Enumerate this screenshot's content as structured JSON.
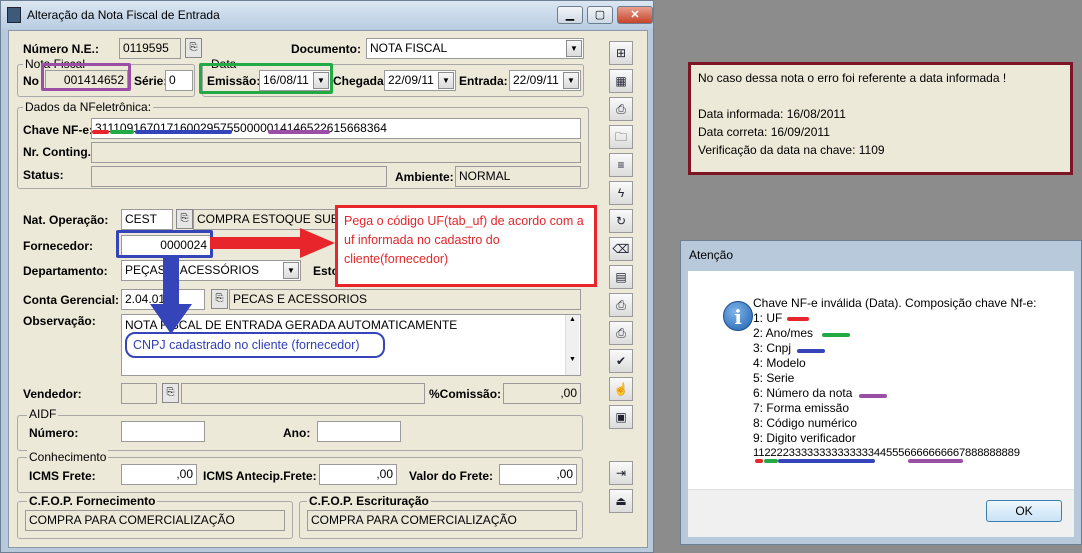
{
  "window": {
    "title": "Alteração da Nota Fiscal de Entrada",
    "minimize_label": "▁",
    "maximize_label": "▢",
    "close_label": "✕"
  },
  "form": {
    "numero_ne_label": "Número N.E.:",
    "numero_ne_value": "0119595",
    "documento_label": "Documento:",
    "documento_value": "NOTA FISCAL",
    "nota_fiscal_group": "Nota Fiscal",
    "no_label": "No",
    "no_value": "001414652",
    "serie_label": "Série:",
    "serie_value": "0",
    "data_group": "Data",
    "emissao_label": "Emissão:",
    "emissao_value": "16/08/11",
    "chegada_label": "Chegada:",
    "chegada_value": "22/09/11",
    "entrada_label": "Entrada:",
    "entrada_value": "22/09/11",
    "nfe_group": "Dados da NFeletrônica:",
    "chave_label": "Chave NF-e:",
    "chave_value": "31110916701716002957550000014146522615668364",
    "contingencia_label": "Nr. Conting.:",
    "status_label": "Status:",
    "ambiente_label": "Ambiente:",
    "ambiente_value": "NORMAL",
    "natop_label": "Nat. Operação:",
    "natop_code": "CEST",
    "natop_desc": "COMPRA ESTOQUE SUB",
    "fornecedor_label": "Fornecedor:",
    "fornecedor_value": "0000024",
    "departamento_label": "Departamento:",
    "departamento_value": "PEÇAS E ACESSÓRIOS",
    "esto_label": "Esto",
    "conta_label": "Conta Gerencial:",
    "conta_code": "2.04.01",
    "conta_desc": "PECAS E ACESSORIOS",
    "observacao_label": "Observação:",
    "observacao_value": "NOTA FISCAL DE ENTRADA GERADA AUTOMATICAMENTE",
    "vendedor_label": "Vendedor:",
    "comissao_label": "%Comissão:",
    "comissao_value": ",00",
    "aidf_group": "AIDF",
    "aidf_numero_label": "Número:",
    "aidf_ano_label": "Ano:",
    "conhecimento_group": "Conhecimento",
    "icms_frete_label": "ICMS Frete:",
    "icms_frete_value": ",00",
    "icms_antecip_label": "ICMS Antecip.Frete:",
    "icms_antecip_value": ",00",
    "valor_frete_label": "Valor do Frete:",
    "valor_frete_value": ",00",
    "cfop_fornec_group": "C.F.O.P. Fornecimento",
    "cfop_fornec_value": "COMPRA PARA COMERCIALIZAÇÃO",
    "cfop_escrit_group": "C.F.O.P. Escrituração",
    "cfop_escrit_value": "COMPRA PARA COMERCIALIZAÇÃO"
  },
  "annotations": {
    "uf_note": "Pega o código UF(tab_uf) de acordo com a uf informada no cadastro do cliente(fornecedor)",
    "cnpj_note": "CNPJ cadastrado no cliente (fornecedor)",
    "colors": {
      "purple": "#9b4ea6",
      "green": "#22aa44",
      "blue": "#3544b8",
      "red": "#e8252b"
    }
  },
  "note_box": {
    "line1": "No caso dessa nota o erro foi referente a data informada !",
    "line2": "Data informada: 16/08/2011",
    "line3": "Data correta: 16/09/2011",
    "line4": "Verificação da data na chave: 1109"
  },
  "dialog": {
    "title": "Atenção",
    "message": "Chave NF-e inválida (Data).  Composição chave Nf-e:",
    "items": [
      "1: UF",
      "2: Ano/mes",
      "3: Cnpj",
      "4: Modelo",
      "5: Serie",
      "6: Número da nota",
      "7: Forma emissão",
      "8: Código numérico",
      "9: Digito verificador"
    ],
    "code": "11222233333333333333445556666666667888888889",
    "ok_label": "OK"
  }
}
